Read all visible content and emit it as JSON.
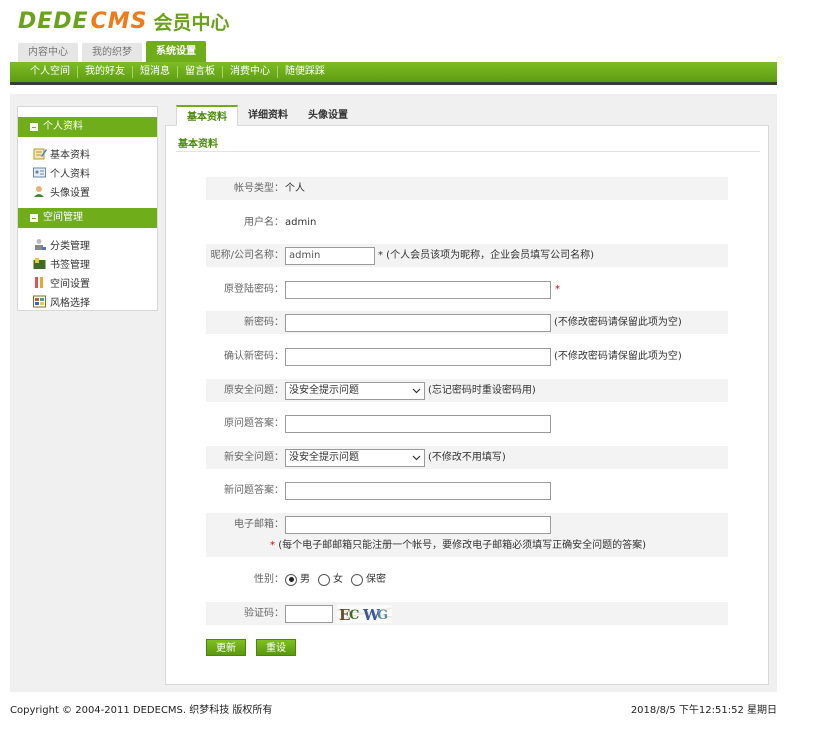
{
  "logo": {
    "part1": "DEDE",
    "part2": "CMS",
    "subtitle": "会员中心"
  },
  "top_tabs": [
    {
      "label": "内容中心"
    },
    {
      "label": "我的织梦"
    },
    {
      "label": "系统设置"
    }
  ],
  "nav": [
    {
      "label": "个人空间"
    },
    {
      "label": "我的好友"
    },
    {
      "label": "短消息"
    },
    {
      "label": "留言板"
    },
    {
      "label": "消费中心"
    },
    {
      "label": "随便踩踩"
    }
  ],
  "sidebar": {
    "groups": [
      {
        "title": "个人资料",
        "items": [
          "基本资料",
          "个人资料",
          "头像设置"
        ]
      },
      {
        "title": "空间管理",
        "items": [
          "分类管理",
          "书签管理",
          "空间设置",
          "风格选择"
        ]
      }
    ]
  },
  "sub_tabs": [
    "基本资料",
    "详细资料",
    "头像设置"
  ],
  "section_title": "基本资料",
  "form": {
    "account_type": {
      "label": "帐号类型：",
      "value": "个人"
    },
    "username": {
      "label": "用户名：",
      "value": "admin"
    },
    "nickname": {
      "label": "昵称/公司名称：",
      "value": "admin",
      "note": "* (个人会员该项为昵称，企业会员填写公司名称)"
    },
    "old_password": {
      "label": "原登陆密码：",
      "star": "*"
    },
    "new_password": {
      "label": "新密码：",
      "note": "(不修改密码请保留此项为空)"
    },
    "confirm_password": {
      "label": "确认新密码：",
      "note": "(不修改密码请保留此项为空)"
    },
    "old_question": {
      "label": "原安全问题：",
      "selected": "没安全提示问题",
      "note": "(忘记密码时重设密码用)"
    },
    "old_answer": {
      "label": "原问题答案："
    },
    "new_question": {
      "label": "新安全问题：",
      "selected": "没安全提示问题",
      "note": "(不修改不用填写)"
    },
    "new_answer": {
      "label": "新问题答案："
    },
    "email": {
      "label": "电子邮箱：",
      "note_star": "*",
      "note": "(每个电子邮邮箱只能注册一个帐号，要修改电子邮箱必须填写正确安全问题的答案)"
    },
    "gender": {
      "label": "性别：",
      "options": [
        "男",
        "女",
        "保密"
      ],
      "selected": "男"
    },
    "captcha": {
      "label": "验证码：",
      "image_text": "ECWG"
    }
  },
  "buttons": {
    "submit": "更新",
    "reset": "重设"
  },
  "footer": {
    "copyright": "Copyright © 2004-2011 DEDECMS. 织梦科技 版权所有",
    "datetime": "2018/8/5 下午12:51:52 星期日"
  },
  "colors": {
    "brand_green": "#6fae1a",
    "brand_orange": "#f07a1a"
  }
}
